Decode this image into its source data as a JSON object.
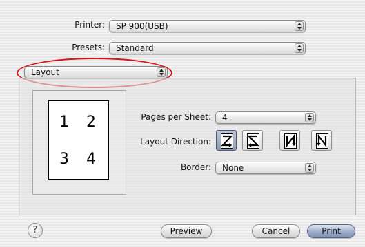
{
  "printer": {
    "label": "Printer:",
    "value": "SP 900(USB)"
  },
  "presets": {
    "label": "Presets:",
    "value": "Standard"
  },
  "pane_selector": {
    "value": "Layout"
  },
  "preview_numbers": [
    "1",
    "2",
    "3",
    "4"
  ],
  "pages_per_sheet": {
    "label": "Pages per Sheet:",
    "value": "4"
  },
  "layout_direction": {
    "label": "Layout Direction:",
    "options": [
      "z-order",
      "reverse-z-order",
      "n-order",
      "reverse-n-order"
    ],
    "selected": "z-order"
  },
  "border": {
    "label": "Border:",
    "value": "None"
  },
  "buttons": {
    "help": "?",
    "preview": "Preview",
    "cancel": "Cancel",
    "print": "Print"
  },
  "colors": {
    "highlight_oval": "#d8101a",
    "selected_button": "#8f9bb0"
  }
}
